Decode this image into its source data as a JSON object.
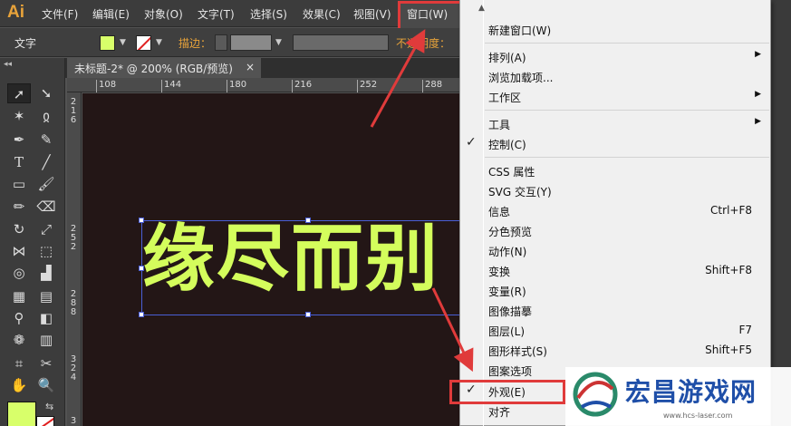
{
  "app": {
    "logo": "Ai"
  },
  "menubar": {
    "items": [
      "文件(F)",
      "编辑(E)",
      "对象(O)",
      "文字(T)",
      "选择(S)",
      "效果(C)",
      "视图(V)",
      "窗口(W)"
    ]
  },
  "controlbar": {
    "tool_label": "文字",
    "stroke_label": "描边：",
    "opacity_label": "不透明度："
  },
  "document": {
    "tab_title": "未标题-2* @ 200% (RGB/预览)",
    "close_glyph": "×",
    "artwork_text": "缘尽而别"
  },
  "ruler": {
    "h_ticks": [
      "108",
      "144",
      "180",
      "216",
      "252",
      "288"
    ],
    "v_ticks": [
      "216",
      "252",
      "288",
      "324",
      "360"
    ]
  },
  "window_menu": {
    "items": [
      {
        "label": "新建窗口(W)"
      },
      {
        "label": "排列(A)",
        "submenu": true
      },
      {
        "label": "浏览加载项..."
      },
      {
        "label": "工作区",
        "submenu": true
      },
      {
        "label": "工具",
        "submenu": true
      },
      {
        "label": "控制(C)",
        "checked": true
      },
      {
        "label": "CSS 属性"
      },
      {
        "label": "SVG 交互(Y)"
      },
      {
        "label": "信息",
        "shortcut": "Ctrl+F8"
      },
      {
        "label": "分色预览"
      },
      {
        "label": "动作(N)"
      },
      {
        "label": "变换",
        "shortcut": "Shift+F8"
      },
      {
        "label": "变量(R)"
      },
      {
        "label": "图像描摹"
      },
      {
        "label": "图层(L)",
        "shortcut": "F7"
      },
      {
        "label": "图形样式(S)",
        "shortcut": "Shift+F5"
      },
      {
        "label": "图案选项"
      },
      {
        "label": "外观(E)",
        "checked": true
      },
      {
        "label": "对齐"
      }
    ]
  },
  "watermark": {
    "title": "宏昌游戏网",
    "url": "www.hcs-laser.com"
  },
  "icons": {
    "check": "check-icon",
    "submenu": "chevron-right-icon",
    "dropdown": "chevron-down-icon"
  },
  "colors": {
    "fill": "#d8ff6a",
    "artwork": "#d4fd5c",
    "canvas": "#231616",
    "highlight": "#e03b3b",
    "accent_logo": "#e8a33a"
  }
}
